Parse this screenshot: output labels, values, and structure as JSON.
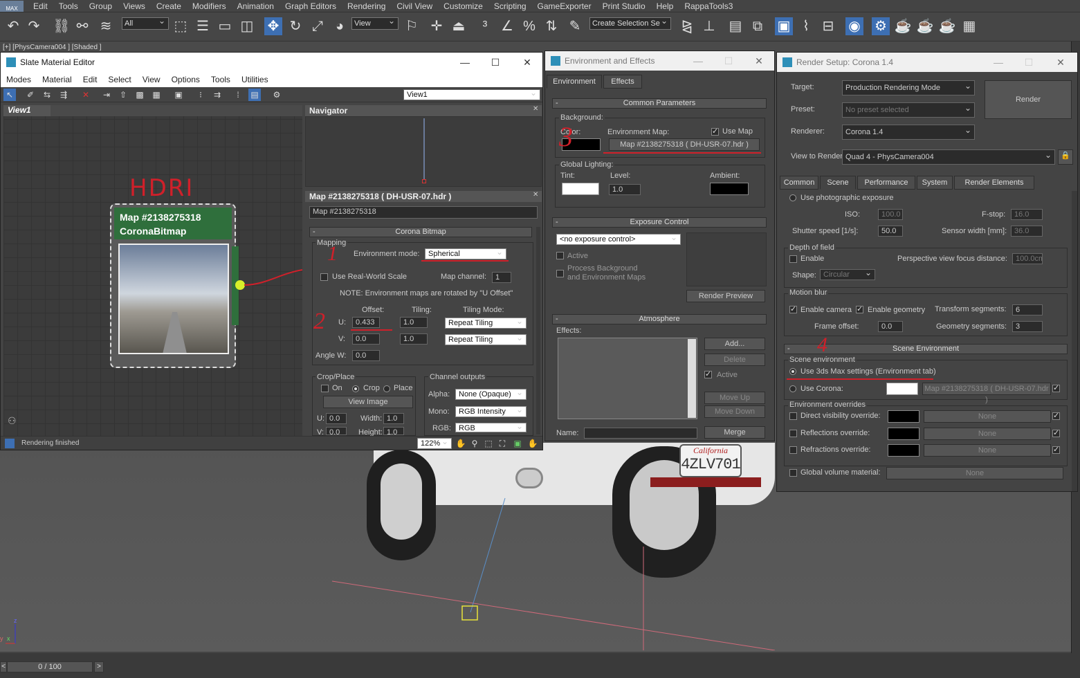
{
  "app": {
    "logo": "MAX",
    "menu": [
      "Edit",
      "Tools",
      "Group",
      "Views",
      "Create",
      "Modifiers",
      "Animation",
      "Graph Editors",
      "Rendering",
      "Civil View",
      "Customize",
      "Scripting",
      "GameExporter",
      "Print Studio",
      "Help",
      "RappaTools3"
    ],
    "toolbar": {
      "filter": "All",
      "refcoord": "View",
      "selection_set": "Create Selection Se"
    }
  },
  "viewport": {
    "label": "[+] [PhysCamera004 ] [Shaded ]",
    "plate_state": "California",
    "plate_number": "4ZLV701",
    "axis_z": "z",
    "axis_x": "x",
    "axis_y": "y"
  },
  "timeline": {
    "frame": "0 / 100",
    "next": ">",
    "prev": "<"
  },
  "slate": {
    "title": "Slate Material Editor",
    "menu": [
      "Modes",
      "Material",
      "Edit",
      "Select",
      "View",
      "Options",
      "Tools",
      "Utilities"
    ],
    "view_select": "View1",
    "view_tab": "View1",
    "navigator": "Navigator",
    "node": {
      "name": "Map #2138275318",
      "type": "CoronaBitmap",
      "annotation": "HDRI"
    },
    "panel_title": "Map #2138275318  ( DH-USR-07.hdr )",
    "panel_name": "Map #2138275318",
    "rollout": "Corona Bitmap",
    "mapping_label": "Mapping",
    "env_mode_label": "Environment mode:",
    "env_mode": "Spherical",
    "real_world": "Use Real-World Scale",
    "map_channel_label": "Map channel:",
    "map_channel": "1",
    "note": "NOTE: Environment maps are rotated by \"U Offset\"",
    "offset_label": "Offset:",
    "tiling_label": "Tiling:",
    "tiling_mode_label": "Tiling Mode:",
    "u_label": "U:",
    "v_label": "V:",
    "u_offset": "0.433",
    "v_offset": "0.0",
    "u_tiling": "1.0",
    "v_tiling": "1.0",
    "u_mode": "Repeat Tiling",
    "v_mode": "Repeat Tiling",
    "angle_label": "Angle W:",
    "angle": "0.0",
    "crop_label": "Crop/Place",
    "on": "On",
    "crop": "Crop",
    "place": "Place",
    "view_image": "View Image",
    "cu_label": "U:",
    "cu": "0.0",
    "width_label": "Width:",
    "width": "1.0",
    "cv_label": "V:",
    "cv": "0.0",
    "height_label": "Height:",
    "height": "1.0",
    "channel_label": "Channel outputs",
    "alpha_label": "Alpha:",
    "alpha": "None (Opaque)",
    "mono_label": "Mono:",
    "mono": "RGB Intensity",
    "rgb_label": "RGB:",
    "rgb": "RGB",
    "status": "Rendering finished",
    "zoom": "122%",
    "anno1": "1",
    "anno2": "2"
  },
  "env": {
    "title": "Environment and Effects",
    "tabs": [
      "Environment",
      "Effects"
    ],
    "common": "Common Parameters",
    "background": "Background:",
    "color_label": "Color:",
    "env_map_label": "Environment Map:",
    "use_map": "Use Map",
    "env_map": "Map #2138275318  ( DH-USR-07.hdr )",
    "global": "Global Lighting:",
    "tint_label": "Tint:",
    "level_label": "Level:",
    "level": "1.0",
    "ambient_label": "Ambient:",
    "exposure": "Exposure Control",
    "exposure_select": "<no exposure control>",
    "active": "Active",
    "process1": "Process Background",
    "process2": "and Environment Maps",
    "render_preview": "Render Preview",
    "atmosphere": "Atmosphere",
    "effects_label": "Effects:",
    "add": "Add...",
    "delete": "Delete",
    "atm_active": "Active",
    "move_up": "Move Up",
    "move_down": "Move Down",
    "name_label": "Name:",
    "merge": "Merge",
    "anno3": "3"
  },
  "render": {
    "title": "Render Setup: Corona 1.4",
    "target_label": "Target:",
    "target": "Production Rendering Mode",
    "preset_label": "Preset:",
    "preset": "No preset selected",
    "renderer_label": "Renderer:",
    "renderer": "Corona 1.4",
    "view_label": "View to Render:",
    "view": "Quad 4 - PhysCamera004",
    "render_btn": "Render",
    "tabs": [
      "Common",
      "Scene",
      "Performance",
      "System",
      "Render Elements"
    ],
    "photo": "Use photographic exposure",
    "iso_label": "ISO:",
    "iso": "100.0",
    "fstop_label": "F-stop:",
    "fstop": "16.0",
    "shutter_label": "Shutter speed [1/s]:",
    "shutter": "50.0",
    "sensor_label": "Sensor width [mm]:",
    "sensor": "36.0",
    "dof": "Depth of field",
    "dof_enable": "Enable",
    "focus_label": "Perspective view focus distance:",
    "focus": "100.0cm",
    "shape_label": "Shape:",
    "shape": "Circular",
    "motion": "Motion blur",
    "enable_camera": "Enable camera",
    "enable_geometry": "Enable geometry",
    "transform_label": "Transform segments:",
    "transform": "6",
    "frame_offset_label": "Frame offset:",
    "frame_offset": "0.0",
    "geometry_label": "Geometry segments:",
    "geometry": "3",
    "scene_env": "Scene Environment",
    "scene_env_label": "Scene environment",
    "use_3ds": "Use 3ds Max settings (Environment tab)",
    "use_corona": "Use Corona:",
    "corona_map": "Map #2138275318  ( DH-USR-07.hdr )",
    "overrides": "Environment overrides",
    "direct": "Direct visibility override:",
    "reflections": "Reflections override:",
    "refractions": "Refractions override:",
    "none": "None",
    "global_vol": "Global volume material:",
    "anno4": "4"
  },
  "colors": {
    "accent": "#3d6fb3",
    "annotation": "#d0202a",
    "node_header": "#2f6f3c"
  }
}
